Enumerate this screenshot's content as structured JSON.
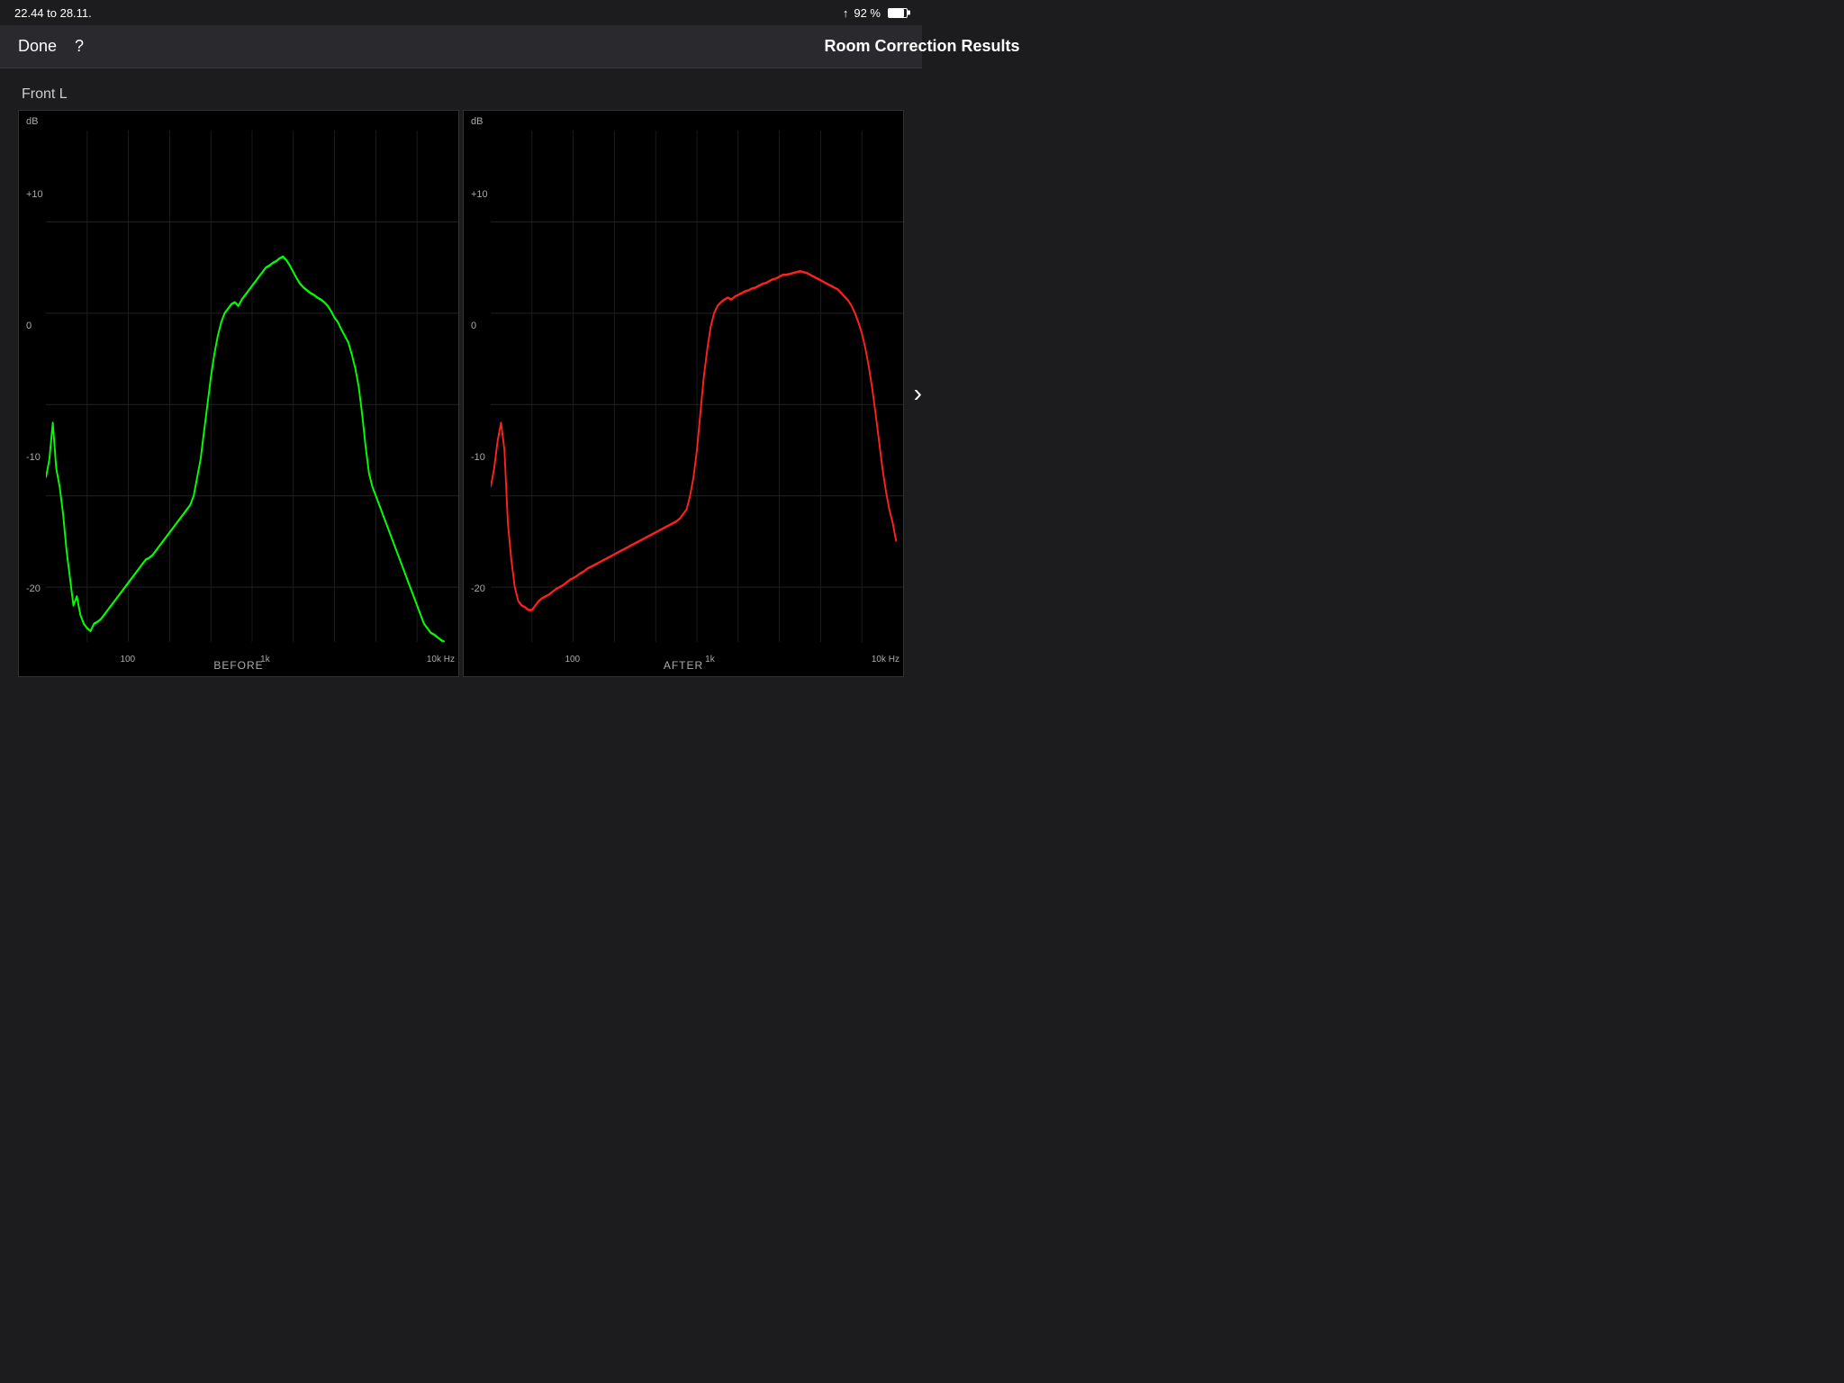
{
  "statusBar": {
    "time": "22.44  to 28.11.",
    "wifi": "▲",
    "battery": "92 %"
  },
  "navBar": {
    "done": "Done",
    "help": "?",
    "title": "Room Correction Results"
  },
  "content": {
    "speakerLabel": "Front L",
    "beforeLabel": "BEFORE",
    "afterLabel": "AFTER",
    "yAxisLabels": [
      "+10",
      "0",
      "-10",
      "-20"
    ],
    "xAxisLabels": [
      "100",
      "1k",
      "10k Hz"
    ],
    "dbLabel": "dB",
    "nextArrow": "›"
  }
}
